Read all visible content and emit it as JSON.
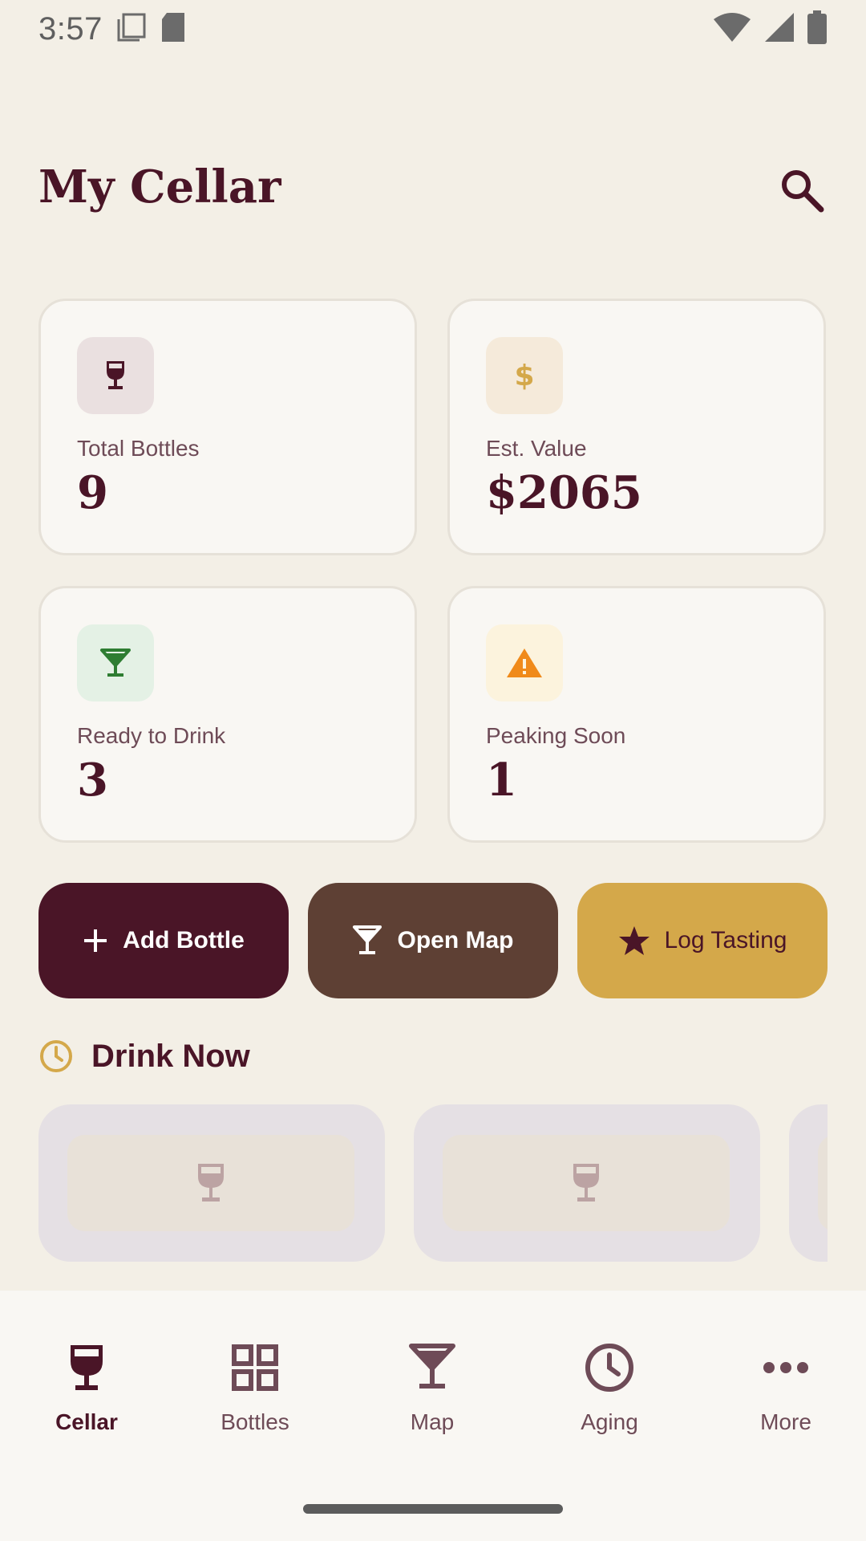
{
  "status_bar": {
    "time": "3:57"
  },
  "header": {
    "title": "My Cellar"
  },
  "stats": [
    {
      "label": "Total Bottles",
      "value": "9",
      "icon": "wine-glass-icon",
      "icon_bg": "#EAE0E0",
      "icon_color": "#4A1527"
    },
    {
      "label": "Est. Value",
      "value": "$2065",
      "icon": "dollar-icon",
      "icon_bg": "#F5EADA",
      "icon_color": "#D4A84A"
    },
    {
      "label": "Ready to Drink",
      "value": "3",
      "icon": "cocktail-glass-icon",
      "icon_bg": "#E4F1E5",
      "icon_color": "#2E7D32"
    },
    {
      "label": "Peaking Soon",
      "value": "1",
      "icon": "warning-icon",
      "icon_bg": "#FCF3DD",
      "icon_color": "#F08A1A"
    }
  ],
  "actions": [
    {
      "label": "Add Bottle",
      "icon": "plus-icon",
      "bg": "#4A1527",
      "fg": "#FFFFFF"
    },
    {
      "label": "Open Map",
      "icon": "cocktail-glass-icon",
      "bg": "#5E4034",
      "fg": "#FFFFFF"
    },
    {
      "label": "Log Tasting",
      "icon": "star-icon",
      "bg": "#D4A84A",
      "fg": "#4A1527"
    }
  ],
  "drink_now": {
    "title": "Drink Now",
    "icon": "clock-icon"
  },
  "nav": {
    "items": [
      {
        "label": "Cellar",
        "icon": "wine-glass-icon",
        "active": true
      },
      {
        "label": "Bottles",
        "icon": "grid-icon",
        "active": false
      },
      {
        "label": "Map",
        "icon": "cocktail-glass-icon",
        "active": false
      },
      {
        "label": "Aging",
        "icon": "clock-icon",
        "active": false
      },
      {
        "label": "More",
        "icon": "more-icon",
        "active": false
      }
    ]
  },
  "colors": {
    "background": "#F3EFE6",
    "primary": "#4A1527",
    "card": "#F9F7F3",
    "gold": "#D4A84A"
  }
}
